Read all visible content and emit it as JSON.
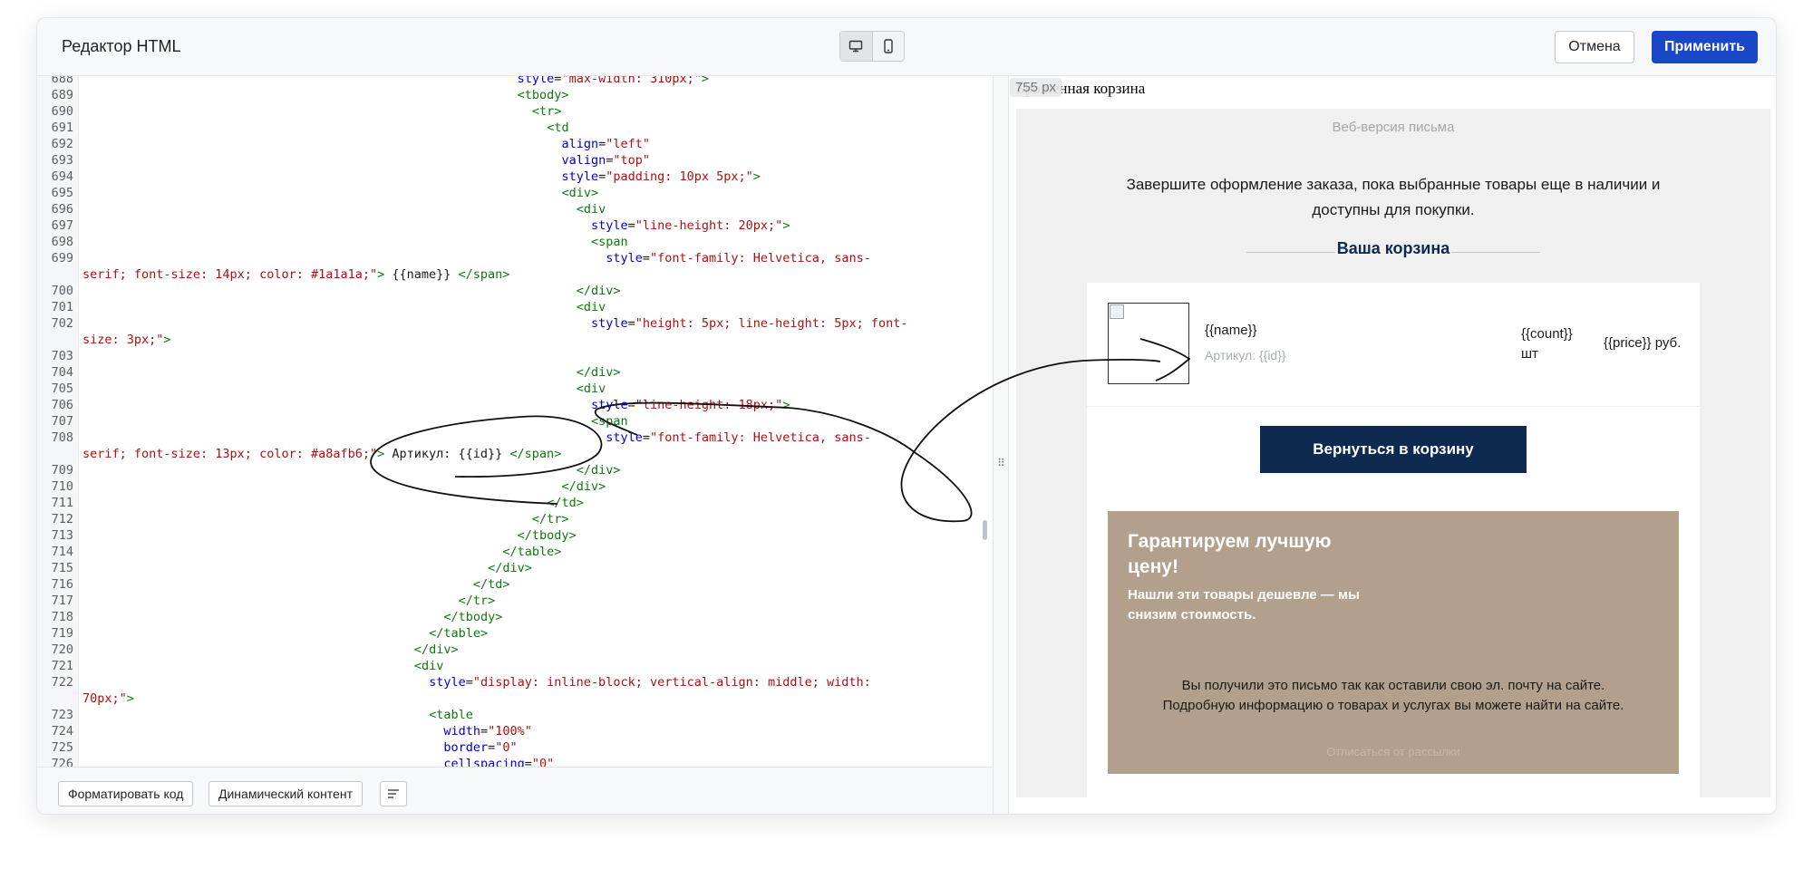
{
  "header": {
    "title": "Редактор HTML",
    "cancel_label": "Отмена",
    "apply_label": "Применить",
    "view_modes": [
      {
        "name": "desktop-icon",
        "glyph": "🖥",
        "active": true
      },
      {
        "name": "mobile-icon",
        "glyph": "▯",
        "active": false
      }
    ]
  },
  "code": {
    "lines": [
      {
        "n": "688",
        "indent": 59,
        "parts": [
          [
            "attr",
            "style"
          ],
          [
            "plain",
            "="
          ],
          [
            "val",
            "\"max-width: 310px;\""
          ],
          [
            "tag",
            ">"
          ]
        ]
      },
      {
        "n": "689",
        "indent": 59,
        "parts": [
          [
            "tag",
            "<tbody>"
          ]
        ]
      },
      {
        "n": "690",
        "indent": 61,
        "parts": [
          [
            "tag",
            "<tr>"
          ]
        ]
      },
      {
        "n": "691",
        "indent": 63,
        "parts": [
          [
            "tag",
            "<td"
          ]
        ]
      },
      {
        "n": "692",
        "indent": 65,
        "parts": [
          [
            "attr",
            "align"
          ],
          [
            "plain",
            "="
          ],
          [
            "val",
            "\"left\""
          ]
        ]
      },
      {
        "n": "693",
        "indent": 65,
        "parts": [
          [
            "attr",
            "valign"
          ],
          [
            "plain",
            "="
          ],
          [
            "val",
            "\"top\""
          ]
        ]
      },
      {
        "n": "694",
        "indent": 65,
        "parts": [
          [
            "attr",
            "style"
          ],
          [
            "plain",
            "="
          ],
          [
            "val",
            "\"padding: 10px 5px;\""
          ],
          [
            "tag",
            ">"
          ]
        ]
      },
      {
        "n": "695",
        "indent": 65,
        "parts": [
          [
            "tag",
            "<div>"
          ]
        ]
      },
      {
        "n": "696",
        "indent": 67,
        "parts": [
          [
            "tag",
            "<div"
          ]
        ]
      },
      {
        "n": "697",
        "indent": 69,
        "parts": [
          [
            "attr",
            "style"
          ],
          [
            "plain",
            "="
          ],
          [
            "val",
            "\"line-height: 20px;\""
          ],
          [
            "tag",
            ">"
          ]
        ]
      },
      {
        "n": "698",
        "indent": 69,
        "parts": [
          [
            "tag",
            "<span"
          ]
        ]
      },
      {
        "n": "699",
        "indent": 71,
        "parts": [
          [
            "attr",
            "style"
          ],
          [
            "plain",
            "="
          ],
          [
            "val",
            "\"font-family: Helvetica, sans-"
          ]
        ]
      },
      {
        "n": "",
        "indent": 0,
        "parts": [
          [
            "val",
            "serif; font-size: 14px; color: #1a1a1a;\""
          ],
          [
            "tag",
            ">"
          ],
          [
            "plain",
            " {{name}} "
          ],
          [
            "tag",
            "</span>"
          ]
        ]
      },
      {
        "n": "700",
        "indent": 67,
        "parts": [
          [
            "tag",
            "</div>"
          ]
        ]
      },
      {
        "n": "701",
        "indent": 67,
        "parts": [
          [
            "tag",
            "<div"
          ]
        ]
      },
      {
        "n": "702",
        "indent": 69,
        "parts": [
          [
            "attr",
            "style"
          ],
          [
            "plain",
            "="
          ],
          [
            "val",
            "\"height: 5px; line-height: 5px; font-"
          ]
        ]
      },
      {
        "n": "",
        "indent": 0,
        "parts": [
          [
            "val",
            "size: 3px;\""
          ],
          [
            "tag",
            ">"
          ]
        ]
      },
      {
        "n": "703",
        "indent": 0,
        "parts": []
      },
      {
        "n": "704",
        "indent": 67,
        "parts": [
          [
            "tag",
            "</div>"
          ]
        ]
      },
      {
        "n": "705",
        "indent": 67,
        "parts": [
          [
            "tag",
            "<div"
          ]
        ]
      },
      {
        "n": "706",
        "indent": 69,
        "parts": [
          [
            "attr",
            "style"
          ],
          [
            "plain",
            "="
          ],
          [
            "val",
            "\"line-height: 18px;\""
          ],
          [
            "tag",
            ">"
          ]
        ]
      },
      {
        "n": "707",
        "indent": 69,
        "parts": [
          [
            "tag",
            "<span"
          ]
        ]
      },
      {
        "n": "708",
        "indent": 71,
        "parts": [
          [
            "attr",
            "style"
          ],
          [
            "plain",
            "="
          ],
          [
            "val",
            "\"font-family: Helvetica, sans-"
          ]
        ]
      },
      {
        "n": "",
        "indent": 0,
        "parts": [
          [
            "val",
            "serif; font-size: 13px; color: #a8afb6;\""
          ],
          [
            "tag",
            ">"
          ],
          [
            "plain",
            " Артикул: {{id}} "
          ],
          [
            "tag",
            "</span>"
          ]
        ]
      },
      {
        "n": "709",
        "indent": 67,
        "parts": [
          [
            "tag",
            "</div>"
          ]
        ]
      },
      {
        "n": "710",
        "indent": 65,
        "parts": [
          [
            "tag",
            "</div>"
          ]
        ]
      },
      {
        "n": "711",
        "indent": 63,
        "parts": [
          [
            "tag",
            "</td>"
          ]
        ]
      },
      {
        "n": "712",
        "indent": 61,
        "parts": [
          [
            "tag",
            "</tr>"
          ]
        ]
      },
      {
        "n": "713",
        "indent": 59,
        "parts": [
          [
            "tag",
            "</tbody>"
          ]
        ]
      },
      {
        "n": "714",
        "indent": 57,
        "parts": [
          [
            "tag",
            "</table>"
          ]
        ]
      },
      {
        "n": "715",
        "indent": 55,
        "parts": [
          [
            "tag",
            "</div>"
          ]
        ]
      },
      {
        "n": "716",
        "indent": 53,
        "parts": [
          [
            "tag",
            "</td>"
          ]
        ]
      },
      {
        "n": "717",
        "indent": 51,
        "parts": [
          [
            "tag",
            "</tr>"
          ]
        ]
      },
      {
        "n": "718",
        "indent": 49,
        "parts": [
          [
            "tag",
            "</tbody>"
          ]
        ]
      },
      {
        "n": "719",
        "indent": 47,
        "parts": [
          [
            "tag",
            "</table>"
          ]
        ]
      },
      {
        "n": "720",
        "indent": 45,
        "parts": [
          [
            "tag",
            "</div>"
          ]
        ]
      },
      {
        "n": "721",
        "indent": 45,
        "parts": [
          [
            "tag",
            "<div"
          ]
        ]
      },
      {
        "n": "722",
        "indent": 47,
        "parts": [
          [
            "attr",
            "style"
          ],
          [
            "plain",
            "="
          ],
          [
            "val",
            "\"display: inline-block; vertical-align: middle; width:"
          ]
        ]
      },
      {
        "n": "",
        "indent": 0,
        "parts": [
          [
            "val",
            "70px;\""
          ],
          [
            "tag",
            ">"
          ]
        ]
      },
      {
        "n": "723",
        "indent": 47,
        "parts": [
          [
            "tag",
            "<table"
          ]
        ]
      },
      {
        "n": "724",
        "indent": 49,
        "parts": [
          [
            "attr",
            "width"
          ],
          [
            "plain",
            "="
          ],
          [
            "val",
            "\"100%\""
          ]
        ]
      },
      {
        "n": "725",
        "indent": 49,
        "parts": [
          [
            "attr",
            "border"
          ],
          [
            "plain",
            "="
          ],
          [
            "val",
            "\"0\""
          ]
        ]
      },
      {
        "n": "726",
        "indent": 49,
        "parts": [
          [
            "attr",
            "cellspacing"
          ],
          [
            "plain",
            "="
          ],
          [
            "val",
            "\"0\""
          ]
        ]
      }
    ]
  },
  "footer": {
    "format_label": "Форматировать код",
    "dynamic_label": "Динамический контент",
    "wrap_icon": "wrap-lines-icon"
  },
  "preview": {
    "width_badge": "755 px",
    "page_title": "Брошенная корзина",
    "web_version": "Веб-версия письма",
    "intro": "Завершите оформление заказа, пока выбранные товары еще в наличии и доступны для покупки.",
    "cart_heading": "Ваша корзина",
    "item": {
      "name": "{{name}}",
      "sku": "Артикул: {{id}}",
      "count": "{{count}}",
      "count_unit": "шт",
      "price": "{{price}} руб."
    },
    "back_button": "Вернуться в корзину",
    "promo": {
      "title": "Гарантируем лучшую цену!",
      "subtitle": "Нашли эти товары дешевле — мы снизим стоимость.",
      "note": "Вы получили это письмо так как оставили свою эл. почту на сайте. Подробную информацию о товарах и услугах вы можете найти на сайте.",
      "unsubscribe": "Отписаться от рассылки"
    }
  },
  "colors": {
    "accent": "#1a47c7",
    "navy": "#0f2a50",
    "promo_bg": "#b2a08d",
    "tag": "#117711",
    "attr": "#0000cc",
    "val": "#aa1111"
  }
}
